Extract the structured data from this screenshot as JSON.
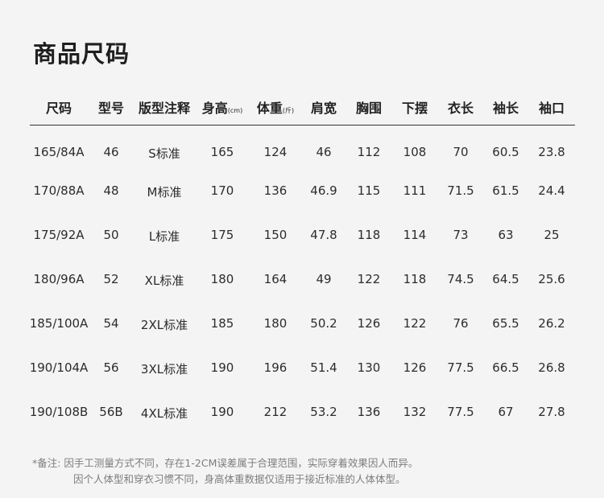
{
  "title": "商品尺码",
  "table": {
    "headers": [
      {
        "text": "尺码"
      },
      {
        "text": "型号"
      },
      {
        "text": "版型注释"
      },
      {
        "text": "身高",
        "unit": "(cm)"
      },
      {
        "text": "体重",
        "unit": "(斤)"
      },
      {
        "text": "肩宽"
      },
      {
        "text": "胸围"
      },
      {
        "text": "下摆"
      },
      {
        "text": "衣长"
      },
      {
        "text": "袖长"
      },
      {
        "text": "袖口"
      }
    ],
    "rows": [
      [
        "165/84A",
        "46",
        "S标准",
        "165",
        "124",
        "46",
        "112",
        "108",
        "70",
        "60.5",
        "23.8"
      ],
      [
        "170/88A",
        "48",
        "M标准",
        "170",
        "136",
        "46.9",
        "115",
        "111",
        "71.5",
        "61.5",
        "24.4"
      ],
      [
        "175/92A",
        "50",
        "L标准",
        "175",
        "150",
        "47.8",
        "118",
        "114",
        "73",
        "63",
        "25"
      ],
      [
        "180/96A",
        "52",
        "XL标准",
        "180",
        "164",
        "49",
        "122",
        "118",
        "74.5",
        "64.5",
        "25.6"
      ],
      [
        "185/100A",
        "54",
        "2XL标准",
        "185",
        "180",
        "50.2",
        "126",
        "122",
        "76",
        "65.5",
        "26.2"
      ],
      [
        "190/104A",
        "56",
        "3XL标准",
        "190",
        "196",
        "51.4",
        "130",
        "126",
        "77.5",
        "66.5",
        "26.8"
      ],
      [
        "190/108B",
        "56B",
        "4XL标准",
        "190",
        "212",
        "53.2",
        "136",
        "132",
        "77.5",
        "67",
        "27.8"
      ]
    ]
  },
  "notes": {
    "line1": "*备注:  因手工测量方式不同，存在1-2CM误差属于合理范围，实际穿着效果因人而异。",
    "line2": "因个人体型和穿衣习惯不同，身高体重数据仅适用于接近标准的人体体型。"
  }
}
